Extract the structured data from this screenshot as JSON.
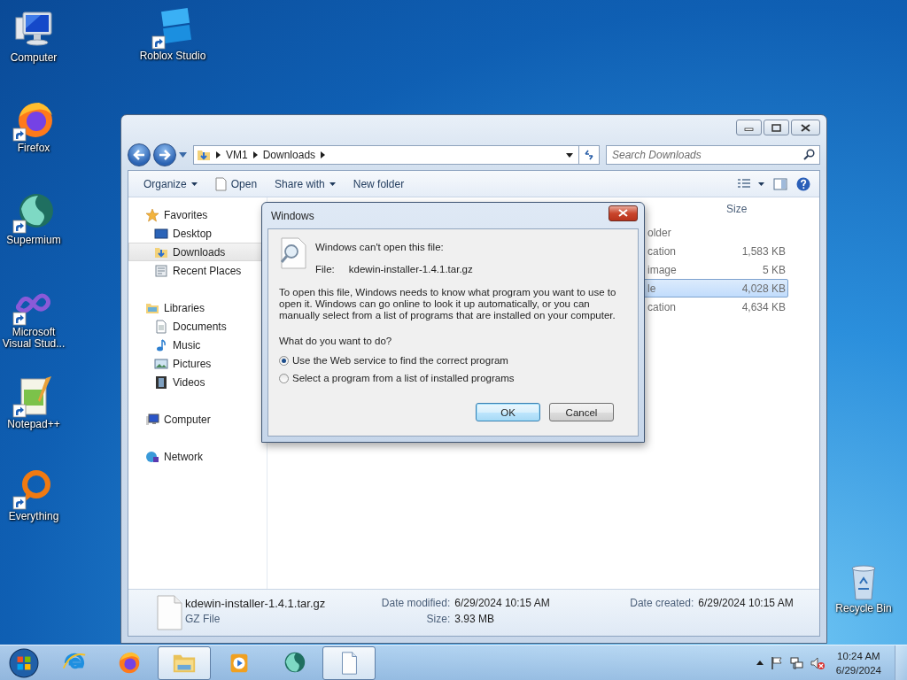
{
  "desktop": {
    "icons": [
      {
        "label": "Computer"
      },
      {
        "label": "Roblox Studio"
      },
      {
        "label": "Firefox"
      },
      {
        "label": "Supermium"
      },
      {
        "label": "Microsoft Visual Stud..."
      },
      {
        "label": "Notepad++"
      },
      {
        "label": "Everything"
      },
      {
        "label": "Recycle Bin"
      }
    ]
  },
  "explorer": {
    "address": [
      "VM1",
      "Downloads"
    ],
    "search": {
      "placeholder": "Search Downloads"
    },
    "toolbar": [
      {
        "label": "Organize",
        "dropdown": true
      },
      {
        "label": "Open",
        "dropdown": false
      },
      {
        "label": "Share with",
        "dropdown": true
      },
      {
        "label": "New folder",
        "dropdown": false
      }
    ],
    "nav": [
      {
        "label": "Favorites",
        "selected": false,
        "children": [
          {
            "label": "Desktop",
            "selected": false
          },
          {
            "label": "Downloads",
            "selected": true
          },
          {
            "label": "Recent Places",
            "selected": false
          }
        ]
      },
      {
        "label": "Libraries",
        "selected": false,
        "children": [
          {
            "label": "Documents",
            "selected": false
          },
          {
            "label": "Music",
            "selected": false
          },
          {
            "label": "Pictures",
            "selected": false
          },
          {
            "label": "Videos",
            "selected": false
          }
        ]
      },
      {
        "label": "Computer",
        "selected": false
      },
      {
        "label": "Network",
        "selected": false
      }
    ],
    "list": {
      "size_header": "Size",
      "rows": [
        {
          "column_2": "older",
          "selected": false
        },
        {
          "column_2": "cation",
          "size": "1,583 KB",
          "selected": false
        },
        {
          "column_2": "image",
          "size": "5 KB",
          "selected": false
        },
        {
          "column_2": "le",
          "size": "4,028 KB",
          "selected": true
        },
        {
          "column_2": "cation",
          "size": "4,634 KB",
          "selected": false
        }
      ]
    },
    "details": {
      "name": "kdewin-installer-1.4.1.tar.gz",
      "type": "GZ File",
      "fields": [
        {
          "label": "Date modified:",
          "value": "6/29/2024 10:15 AM"
        },
        {
          "label": "Size:",
          "value": "3.93 MB"
        },
        {
          "label": "Date created:",
          "value": "6/29/2024 10:15 AM"
        }
      ]
    }
  },
  "dialog": {
    "title": "Windows",
    "heading": "Windows can't open this file:",
    "file_label": "File:",
    "file_name": "kdewin-installer-1.4.1.tar.gz",
    "message": "To open this file, Windows needs to know what program you want to use to open it. Windows can go online to look it up automatically, or you can manually select from a list of programs that are installed on your computer.",
    "question": "What do you want to do?",
    "options": [
      {
        "label": "Use the Web service to find the correct program",
        "selected": true
      },
      {
        "label": "Select a program from a list of installed programs",
        "selected": false
      }
    ],
    "buttons": [
      {
        "label": "OK",
        "default": true
      },
      {
        "label": "Cancel",
        "default": false
      }
    ]
  },
  "taskbar": {
    "items": [
      {
        "active": false
      },
      {
        "active": false
      },
      {
        "active": true
      },
      {
        "active": false
      },
      {
        "active": false
      },
      {
        "active": true
      }
    ],
    "clock": {
      "time": "10:24 AM",
      "date": "6/29/2024"
    }
  }
}
